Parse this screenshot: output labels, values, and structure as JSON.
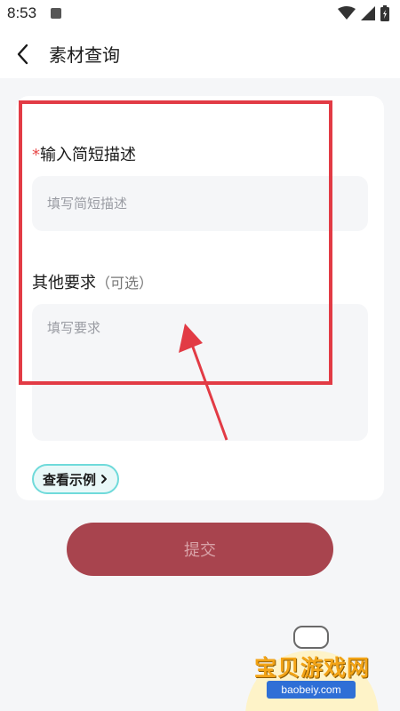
{
  "status_bar": {
    "time": "8:53",
    "icons": [
      "app-notification-icon",
      "wifi-icon",
      "cellular-signal-icon",
      "battery-charging-icon"
    ]
  },
  "app_bar": {
    "back_icon": "chevron-left-icon",
    "title": "素材查询"
  },
  "form": {
    "description": {
      "required_mark": "*",
      "label": "输入简短描述",
      "placeholder": "填写简短描述",
      "value": ""
    },
    "other_requirements": {
      "label": "其他要求",
      "optional_hint": "（可选）",
      "placeholder": "填写要求",
      "value": ""
    },
    "example_button": {
      "label": "查看示例",
      "icon": "chevron-right-icon"
    }
  },
  "submit_button": {
    "label": "提交"
  },
  "colors": {
    "accent_submit": "#a8444e",
    "required": "#e84a4a",
    "annotation_red": "#e23b45",
    "example_border": "#6fdada"
  },
  "watermark": {
    "title": "宝贝游戏网",
    "url": "baobeiy.com"
  }
}
